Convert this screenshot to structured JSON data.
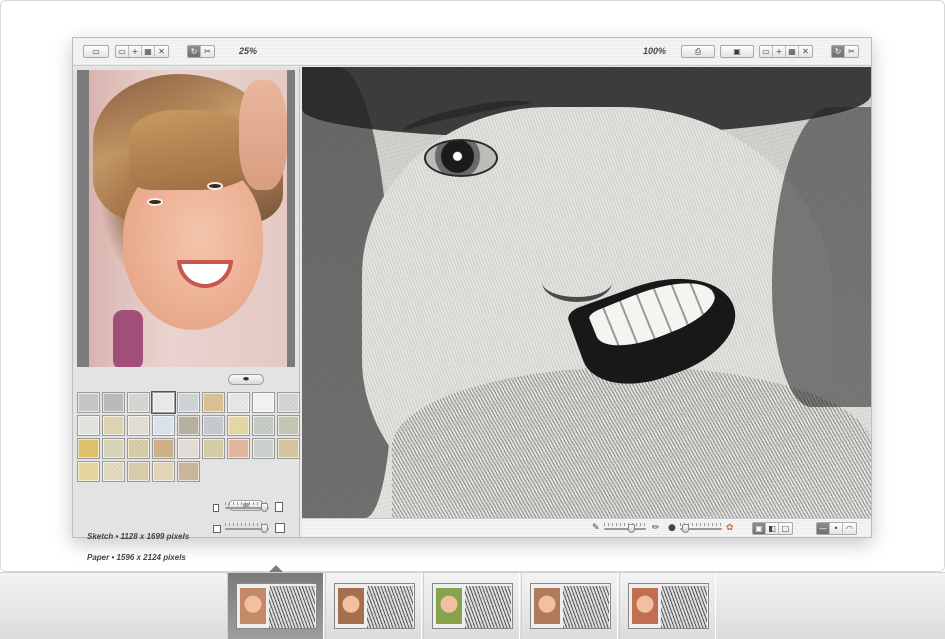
{
  "toolbar": {
    "zoom_left": "25%",
    "zoom_right": "100%",
    "open_icon": "folder-icon",
    "rotate_icon": "rotate-icon",
    "cut_icon": "scissors-icon",
    "print_icon": "printer-icon",
    "save_icon": "save-icon"
  },
  "left_panel": {
    "sketch_info": "Sketch  •  1128 x 1699 pixels",
    "paper_info": "Paper  •  1596 x 2124 pixels",
    "eraser_icon": "eraser-icon",
    "delete_icon": "trash-icon",
    "paper_swatches": [
      "#c9c9c9",
      "#bdbdbd",
      "#d8d8d4",
      "#ececec",
      "#d1d6da",
      "#dcc493",
      "#e9e9e9",
      "#f5f5f5",
      "#d6d6d2",
      "#e6e6e2",
      "#e2d6b5",
      "#e3e0d5",
      "#dde6f0",
      "#b9b3a2",
      "#c9ccd0",
      "#e8d9a9",
      "#c7cfc7",
      "#c8c8b5",
      "#e1c46e",
      "#d9d7b9",
      "#d8cfa6",
      "#cfb488",
      "#e7dfd7",
      "#d6cfa9",
      "#e5b9a0",
      "#cfd6d0",
      "#d9c8a2",
      "#ead8a2",
      "#e4dcc1",
      "#dccfaf",
      "#e6d8b7",
      "#cdb79f"
    ]
  },
  "preview_bar": {
    "pencil_icon": "pencil-icon",
    "color_icon": "color-wheel-icon"
  },
  "thumbnails": [
    {
      "a": "#c48a68",
      "b": "#333"
    },
    {
      "a": "#a56e4c",
      "b": "#777"
    },
    {
      "a": "#86a24c",
      "b": "#b59a40"
    },
    {
      "a": "#b27a5c",
      "b": "#888"
    },
    {
      "a": "#c07050",
      "b": "#555"
    }
  ]
}
